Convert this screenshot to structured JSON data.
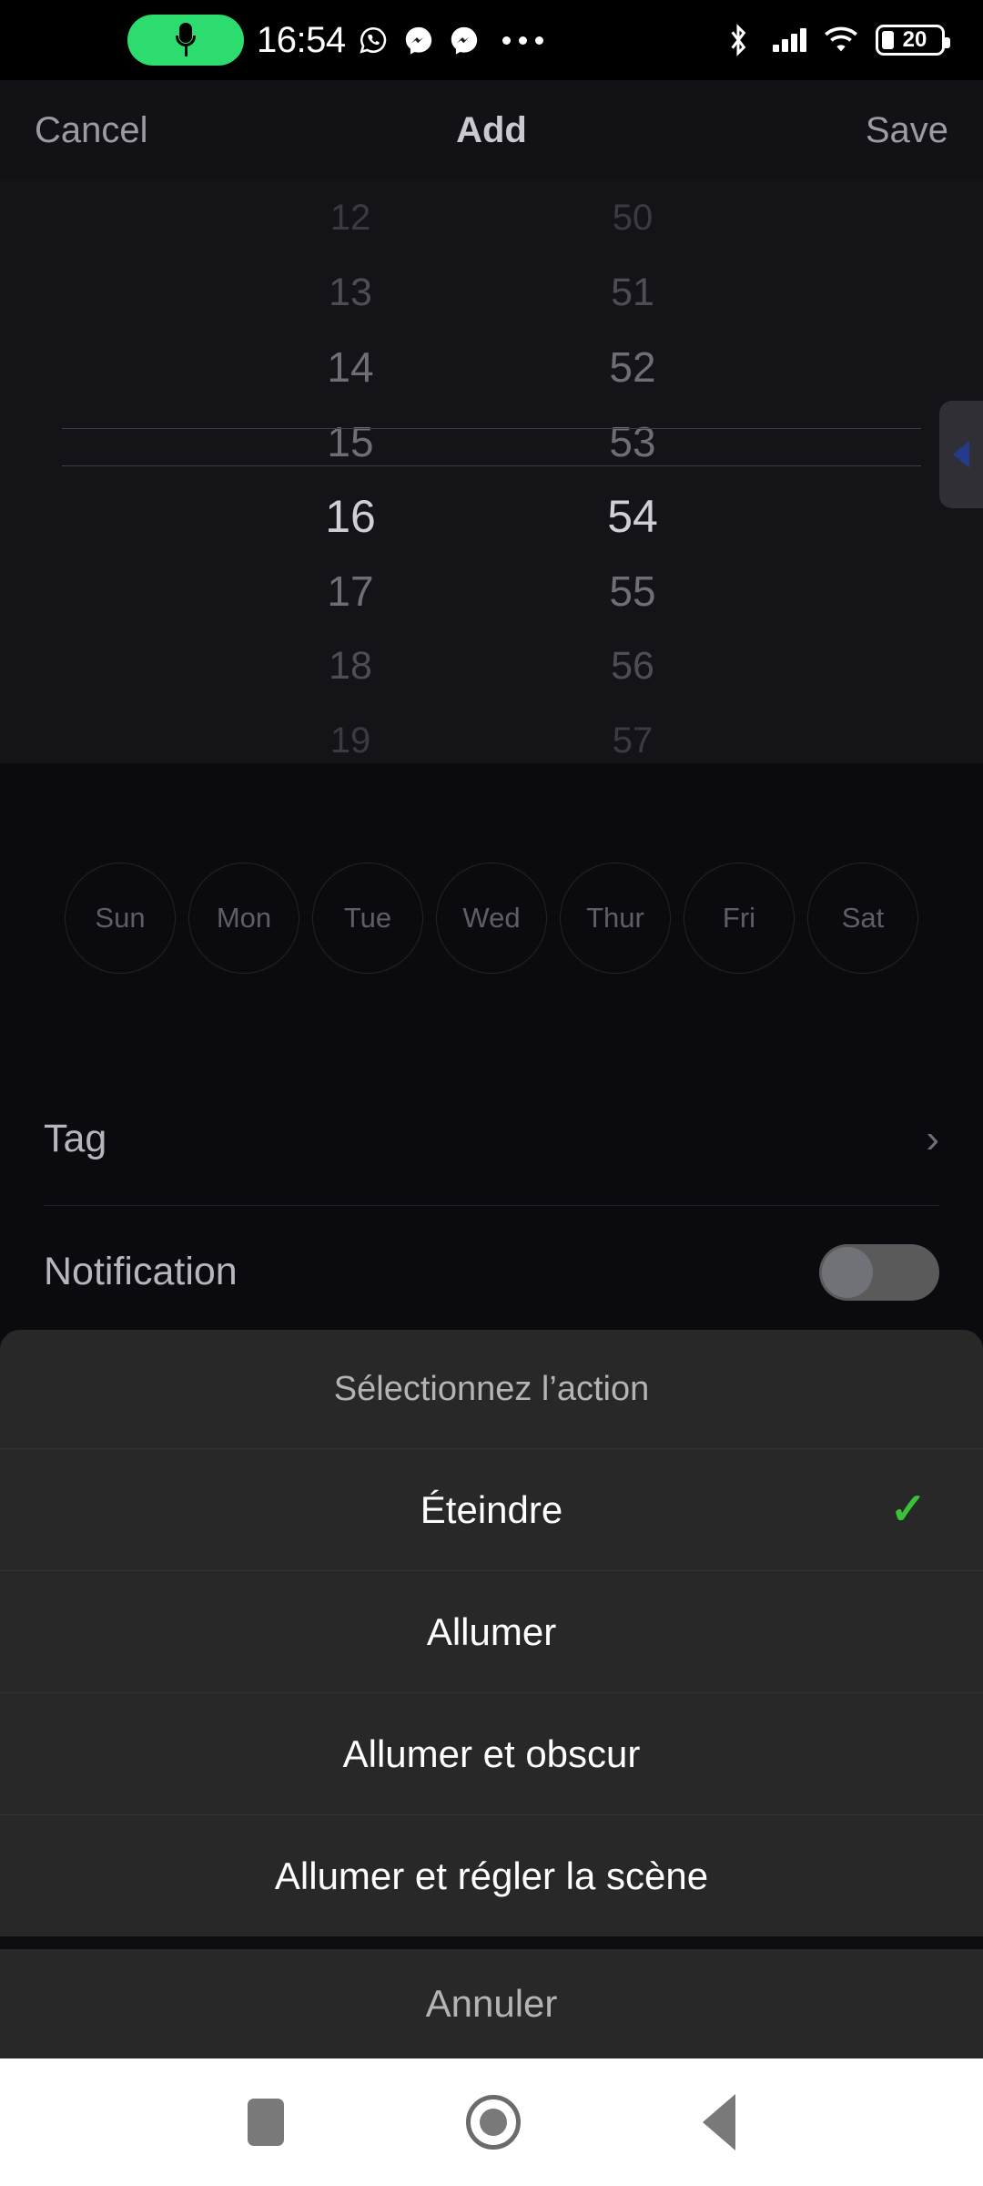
{
  "statusbar": {
    "time": "16:54",
    "mic_icon": "microphone-icon",
    "whatsapp_icon": "whatsapp-icon",
    "messenger_icon_1": "messenger-icon",
    "messenger_icon_2": "messenger-icon",
    "more_icon": "more-dots-icon",
    "bluetooth_icon": "bluetooth-icon",
    "signal_icon": "cellular-signal-icon",
    "wifi_icon": "wifi-icon",
    "battery_icon": "battery-icon",
    "battery_percent": "20",
    "mic_pill_color": "#2ddc6e"
  },
  "header": {
    "cancel_label": "Cancel",
    "title": "Add",
    "save_label": "Save"
  },
  "time_picker": {
    "hours": [
      "12",
      "13",
      "14",
      "15",
      "16",
      "17",
      "18",
      "19"
    ],
    "minutes": [
      "50",
      "51",
      "52",
      "53",
      "54",
      "55",
      "56",
      "57"
    ],
    "selected_hour": "16",
    "selected_minute": "54"
  },
  "days": {
    "items": [
      {
        "label": "Sun",
        "selected": false
      },
      {
        "label": "Mon",
        "selected": false
      },
      {
        "label": "Tue",
        "selected": false
      },
      {
        "label": "Wed",
        "selected": false
      },
      {
        "label": "Thur",
        "selected": false
      },
      {
        "label": "Fri",
        "selected": false
      },
      {
        "label": "Sat",
        "selected": false
      }
    ]
  },
  "rows": {
    "tag_label": "Tag",
    "tag_chevron": "›",
    "notification_label": "Notification",
    "notification_on": false
  },
  "edge_tab": {
    "icon": "triangle-left-icon",
    "color": "#243a8c"
  },
  "action_sheet": {
    "title": "Sélectionnez l’action",
    "options": [
      {
        "label": "Éteindre",
        "selected": true
      },
      {
        "label": "Allumer",
        "selected": false
      },
      {
        "label": "Allumer et obscur",
        "selected": false
      },
      {
        "label": "Allumer et régler la scène",
        "selected": false
      }
    ],
    "check_glyph": "✓",
    "check_color": "#3ac13a",
    "cancel_label": "Annuler"
  },
  "navbar": {
    "recents_icon": "square-recents-icon",
    "home_icon": "circle-home-icon",
    "back_icon": "triangle-back-icon"
  }
}
